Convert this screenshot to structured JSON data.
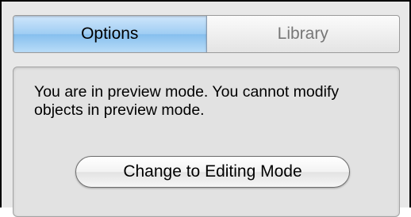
{
  "tabs": [
    {
      "label": "Options",
      "active": true
    },
    {
      "label": "Library",
      "active": false
    }
  ],
  "panel": {
    "message": "You are in preview mode.  You cannot modify objects in preview mode.",
    "button_label": "Change to Editing Mode"
  },
  "colors": {
    "active_tab": "#9fcdf3",
    "panel_background": "#e2e2e2",
    "window_background": "#e8e8e8"
  }
}
